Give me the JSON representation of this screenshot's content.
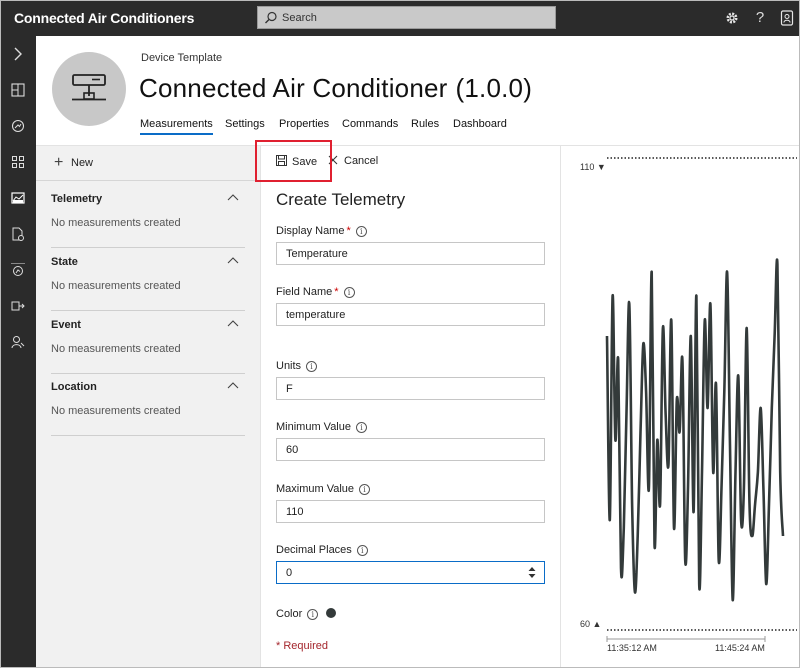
{
  "app": {
    "title": "Connected Air Conditioners",
    "search_placeholder": "Search",
    "settings_icon": "gear-icon",
    "help_label": "?",
    "account_icon": "user-icon"
  },
  "rail": {
    "items": [
      "expand-icon",
      "dashboard-icon",
      "explorer-icon",
      "apps-icon",
      "device-templates-icon",
      "jobs-icon",
      "analytics-icon",
      "export-icon",
      "admin-icon"
    ]
  },
  "header": {
    "subtitle": "Device Template",
    "title": "Connected Air Conditioner",
    "version": "(1.0.0)",
    "tabs": [
      "Measurements",
      "Settings",
      "Properties",
      "Commands",
      "Rules",
      "Dashboard"
    ],
    "active_tab": "Measurements"
  },
  "left_panel": {
    "new_label": "New",
    "sections": [
      {
        "title": "Telemetry",
        "empty_text": "No measurements created"
      },
      {
        "title": "State",
        "empty_text": "No measurements created"
      },
      {
        "title": "Event",
        "empty_text": "No measurements created"
      },
      {
        "title": "Location",
        "empty_text": "No measurements created"
      }
    ]
  },
  "form": {
    "save_label": "Save",
    "cancel_label": "Cancel",
    "title": "Create Telemetry",
    "display_name": {
      "label": "Display Name",
      "required_mark": "*",
      "value": "Temperature"
    },
    "field_name": {
      "label": "Field Name",
      "required_mark": "*",
      "value": "temperature"
    },
    "units": {
      "label": "Units",
      "value": "F"
    },
    "minimum": {
      "label": "Minimum Value",
      "value": "60"
    },
    "maximum": {
      "label": "Maximum Value",
      "value": "110"
    },
    "decimals": {
      "label": "Decimal Places",
      "value": "0"
    },
    "color": {
      "label": "Color",
      "value": "#333a3a"
    },
    "required_note": "* Required",
    "info_glyph": "i"
  },
  "chart_data": {
    "type": "line",
    "y_max_label": "110 ▼",
    "y_min_label": "60 ▲",
    "ylim": [
      60,
      110
    ],
    "x_ticks": [
      "11:35:12 AM",
      "11:45:24 AM"
    ],
    "series": [
      {
        "color": "#333a3a",
        "values": [
          95,
          72,
          100,
          82,
          92,
          66,
          71,
          86,
          99,
          74,
          63,
          70,
          83,
          94,
          88,
          76,
          103,
          69,
          82,
          74,
          96,
          85,
          79,
          97,
          71,
          87,
          83,
          92,
          67,
          76,
          95,
          73,
          100,
          64,
          78,
          97,
          86,
          99,
          78,
          89,
          67,
          76,
          88,
          103,
          82,
          62,
          78,
          90,
          72,
          76,
          96,
          74,
          70,
          74,
          78,
          86,
          76,
          64,
          74,
          86,
          95,
          104,
          78,
          70
        ]
      }
    ]
  }
}
